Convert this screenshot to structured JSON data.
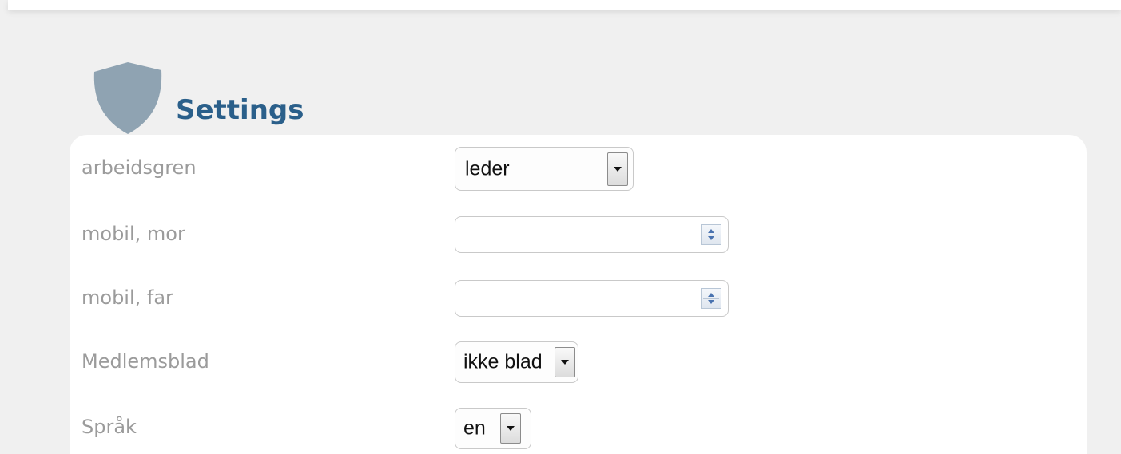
{
  "header": {
    "title": "Settings",
    "icon": "shield-icon",
    "title_color": "#2a5f8a",
    "icon_color": "#8fa3b2"
  },
  "form": {
    "rows": [
      {
        "label": "arbeidsgren",
        "control": "select",
        "value": "leder"
      },
      {
        "label": "mobil, mor",
        "control": "number",
        "value": ""
      },
      {
        "label": "mobil, far",
        "control": "number",
        "value": ""
      },
      {
        "label": "Medlemsblad",
        "control": "select",
        "value": "ikke blad"
      },
      {
        "label": "Språk",
        "control": "select",
        "value": "en"
      }
    ]
  }
}
